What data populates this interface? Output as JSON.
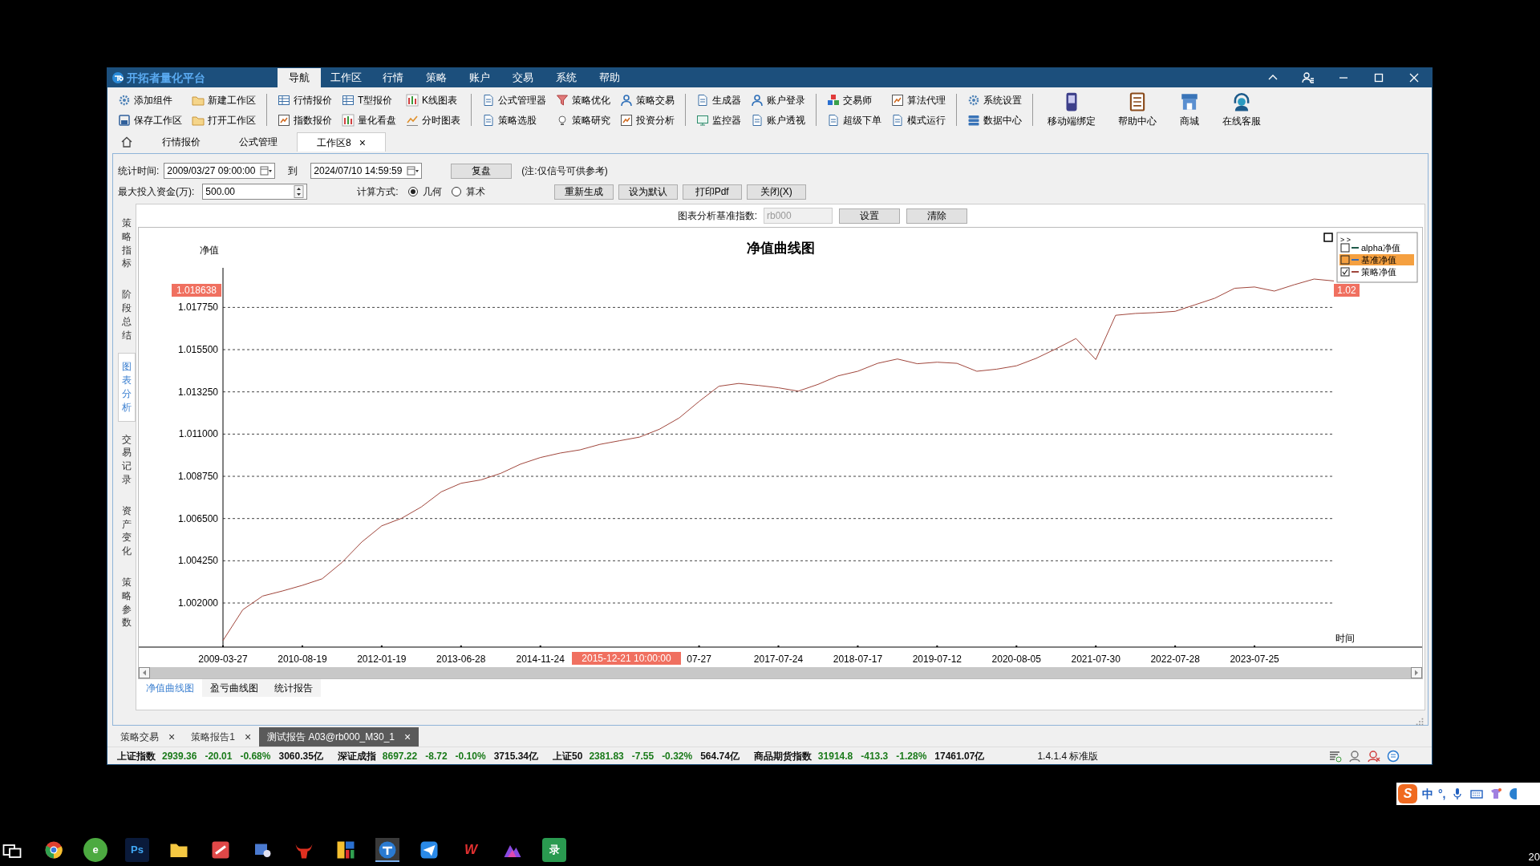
{
  "window": {
    "title": "开拓者量化平台",
    "menu": [
      {
        "label": "导航",
        "selected": true
      },
      {
        "label": "工作区",
        "selected": false
      },
      {
        "label": "行情",
        "selected": false
      },
      {
        "label": "策略",
        "selected": false
      },
      {
        "label": "账户",
        "selected": false
      },
      {
        "label": "交易",
        "selected": false
      },
      {
        "label": "系统",
        "selected": false
      },
      {
        "label": "帮助",
        "selected": false
      }
    ]
  },
  "toolbar": {
    "groups": [
      {
        "items": [
          "添加组件",
          "保存工作区",
          "新建工作区",
          "打开工作区"
        ]
      },
      {
        "items": [
          "行情报价",
          "指数报价",
          "T型报价",
          "量化看盘",
          "K线图表",
          "分时图表"
        ]
      },
      {
        "items": [
          "公式管理器",
          "策略选股",
          "策略优化",
          "策略研究",
          "策略交易",
          "投资分析"
        ]
      },
      {
        "items": [
          "生成器",
          "监控器",
          "账户登录",
          "账户透视"
        ]
      },
      {
        "items": [
          "交易师",
          "超级下单",
          "算法代理",
          "模式运行"
        ]
      },
      {
        "items": [
          "系统设置",
          "数据中心"
        ]
      }
    ],
    "large_buttons": [
      "移动端绑定",
      "帮助中心",
      "商城",
      "在线客服"
    ]
  },
  "tabs": [
    {
      "label": "行情报价",
      "selected": false
    },
    {
      "label": "公式管理",
      "selected": false
    },
    {
      "label": "工作区8",
      "selected": true,
      "close": "×"
    }
  ],
  "form": {
    "period_label": "统计时间:",
    "start": "2009/03/27 09:00:00",
    "to_label": "到",
    "end": "2024/07/10 14:59:59",
    "replay_button": "复盘",
    "note": "(注:仅信号可供参考)",
    "capital_label": "最大投入资金(万):",
    "capital": "500.00",
    "method_label": "计算方式:",
    "methods": [
      {
        "label": "几何",
        "selected": true
      },
      {
        "label": "算术",
        "selected": false
      }
    ],
    "buttons": [
      "重新生成",
      "设为默认",
      "打印Pdf",
      "关闭(X)"
    ],
    "baseline_label": "图表分析基准指数:",
    "baseline": {
      "value": "rb000",
      "disabled": true
    },
    "baseline_buttons": [
      "设置",
      "清除"
    ]
  },
  "side_tabs": [
    {
      "label": "策略指标",
      "selected": false
    },
    {
      "label": "阶段总结",
      "selected": false
    },
    {
      "label": "图表分析",
      "selected": true
    },
    {
      "label": "交易记录",
      "selected": false
    },
    {
      "label": "资产变化",
      "selected": false
    },
    {
      "label": "策略参数",
      "selected": false
    }
  ],
  "chart": {
    "legend_toggle": "> >",
    "legend": [
      {
        "label": "alpha净值",
        "checked": false,
        "selected": false,
        "color": "#1f5a4a"
      },
      {
        "label": "基准净值",
        "checked": false,
        "selected": true,
        "color": "#3a6ab0"
      },
      {
        "checked": true,
        "selected": false,
        "color": "#a0463c"
      }
    ],
    "cursor_labels": {
      "value": "1.018638",
      "last": "1.02",
      "time": "2015-12-21 10:00:00"
    },
    "chart_data": {
      "type": "line",
      "title": "净值曲线图",
      "xlabel": "时间",
      "ylabel": "净值",
      "categories": [
        "2009-03-27",
        null,
        null,
        null,
        "2010-08-19",
        null,
        null,
        null,
        "2012-01-19",
        null,
        null,
        null,
        "2013-06-28",
        null,
        null,
        null,
        "2014-11-24",
        null,
        null,
        null,
        null,
        null,
        null,
        null,
        "07-27",
        null,
        null,
        null,
        "2017-07-24",
        null,
        null,
        null,
        "2018-07-17",
        null,
        null,
        null,
        "2019-07-12",
        null,
        null,
        null,
        "2020-08-05",
        null,
        null,
        null,
        "2021-07-30",
        null,
        null,
        null,
        "2022-07-28",
        null,
        null,
        null,
        "2023-07-25",
        null,
        null,
        null,
        null
      ],
      "series": [
        {
          "name": "策略净值",
          "color": "#a0463c",
          "values": [
            1.0,
            1.00164,
            1.00237,
            1.00264,
            1.00294,
            1.00329,
            1.00416,
            1.00525,
            1.00611,
            1.00651,
            1.00712,
            1.00792,
            1.00838,
            1.00856,
            1.00891,
            1.0094,
            1.00975,
            1.00999,
            1.01016,
            1.01045,
            1.01065,
            1.01084,
            1.01126,
            1.01186,
            1.01274,
            1.01355,
            1.0137,
            1.01359,
            1.01347,
            1.01329,
            1.01365,
            1.0141,
            1.01435,
            1.01477,
            1.015,
            1.01475,
            1.01483,
            1.01477,
            1.01435,
            1.01446,
            1.01464,
            1.01504,
            1.01555,
            1.01609,
            1.01497,
            1.01733,
            1.01743,
            1.01747,
            1.01754,
            1.01789,
            1.01824,
            1.01877,
            1.01884,
            1.01862,
            1.01896,
            1.01926,
            1.01916
          ]
        }
      ],
      "ylim": [
        0.99965,
        1.01986
      ],
      "grid": true,
      "yticks": [
        {
          "value": 1.002,
          "label": "1.002000"
        },
        {
          "value": 1.00425,
          "label": "1.004250"
        },
        {
          "value": 1.0065,
          "label": "1.006500"
        },
        {
          "value": 1.00875,
          "label": "1.008750"
        },
        {
          "value": 1.011,
          "label": "1.011000"
        },
        {
          "value": 1.01325,
          "label": "1.013250"
        },
        {
          "value": 1.0155,
          "label": "1.015500"
        },
        {
          "value": 1.01775,
          "label": "1.017750"
        }
      ]
    }
  },
  "chart_tabs": [
    {
      "label": "净值曲线图",
      "selected": true
    },
    {
      "label": "盈亏曲线图",
      "selected": false
    },
    {
      "label": "统计报告",
      "selected": false
    }
  ],
  "doc_tabs": [
    {
      "label": "策略交易",
      "selected": false,
      "close": "×"
    },
    {
      "label": "策略报告1",
      "selected": false,
      "close": "×"
    },
    {
      "label": "测试报告 A03@rb000_M30_1",
      "selected": true,
      "close": "×"
    }
  ],
  "status_bar": {
    "indices": [
      {
        "name": "上证指数",
        "price": "2939.36",
        "change": "-20.01",
        "percent": "-0.68%",
        "turnover": "3060.35亿"
      },
      {
        "name": "深证成指",
        "price": "8697.22",
        "change": "-8.72",
        "percent": "-0.10%",
        "turnover": "3715.34亿"
      },
      {
        "name": "上证50",
        "price": "2381.83",
        "change": "-7.55",
        "percent": "-0.32%",
        "turnover": "564.74亿"
      },
      {
        "name": "商品期货指数",
        "price": "31914.8",
        "change": "-413.3",
        "percent": "-1.28%",
        "turnover": "17461.07亿"
      }
    ],
    "version": "1.4.1.4 标准版"
  },
  "ime": {
    "logo": "S",
    "mode": "中",
    "punct": "°,"
  },
  "taskbar": {
    "items": [
      {
        "selected": false
      },
      {
        "selected": false
      },
      {
        "selected": false,
        "text": "e"
      },
      {
        "selected": false,
        "text": "Ps"
      },
      {
        "selected": false
      },
      {
        "selected": false
      },
      {
        "selected": false
      },
      {
        "selected": false
      },
      {
        "selected": false
      },
      {
        "selected": true
      },
      {
        "selected": false
      },
      {
        "selected": false,
        "text": "W"
      },
      {
        "selected": false
      },
      {
        "selected": false,
        "text": "录"
      }
    ],
    "clock": "20"
  }
}
